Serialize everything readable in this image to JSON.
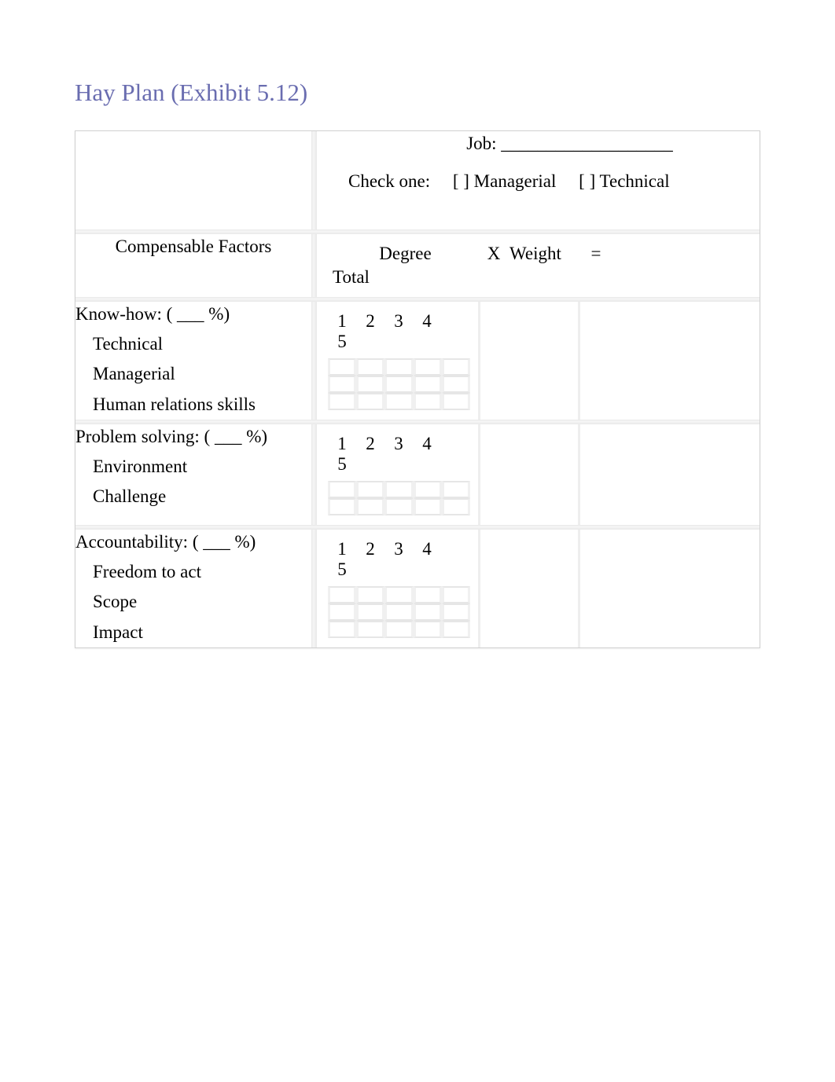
{
  "title": "Hay Plan   (Exhibit 5.12)",
  "header": {
    "job_label": "Job: ___________________",
    "check_one_label": "Check one:",
    "managerial_label": "[   ] Managerial",
    "technical_label": "[   ] Technical"
  },
  "columns": {
    "factors_label": "Compensable Factors",
    "degree_label": "Degree",
    "x_label": "X",
    "weight_label": "Weight",
    "eq_label": "=",
    "total_label": "Total"
  },
  "scale": {
    "n1": "1",
    "n2": "2",
    "n3": "3",
    "n4": "4",
    "n5": "5"
  },
  "factors": [
    {
      "name": "Know-how: ( ___ %)",
      "subs": [
        "Technical",
        "Managerial",
        "Human relations skills"
      ]
    },
    {
      "name": "Problem solving: ( ___ %)",
      "subs": [
        "Environment",
        "Challenge"
      ]
    },
    {
      "name": "Accountability: ( ___ %)",
      "subs": [
        "Freedom to act",
        "Scope",
        "Impact"
      ]
    }
  ]
}
